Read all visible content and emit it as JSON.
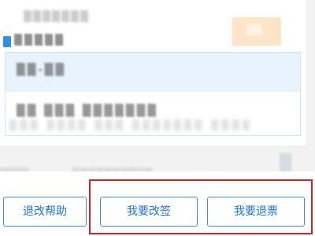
{
  "buttons": {
    "help": "退改帮助",
    "change": "我要改签",
    "refund": "我要退票"
  }
}
